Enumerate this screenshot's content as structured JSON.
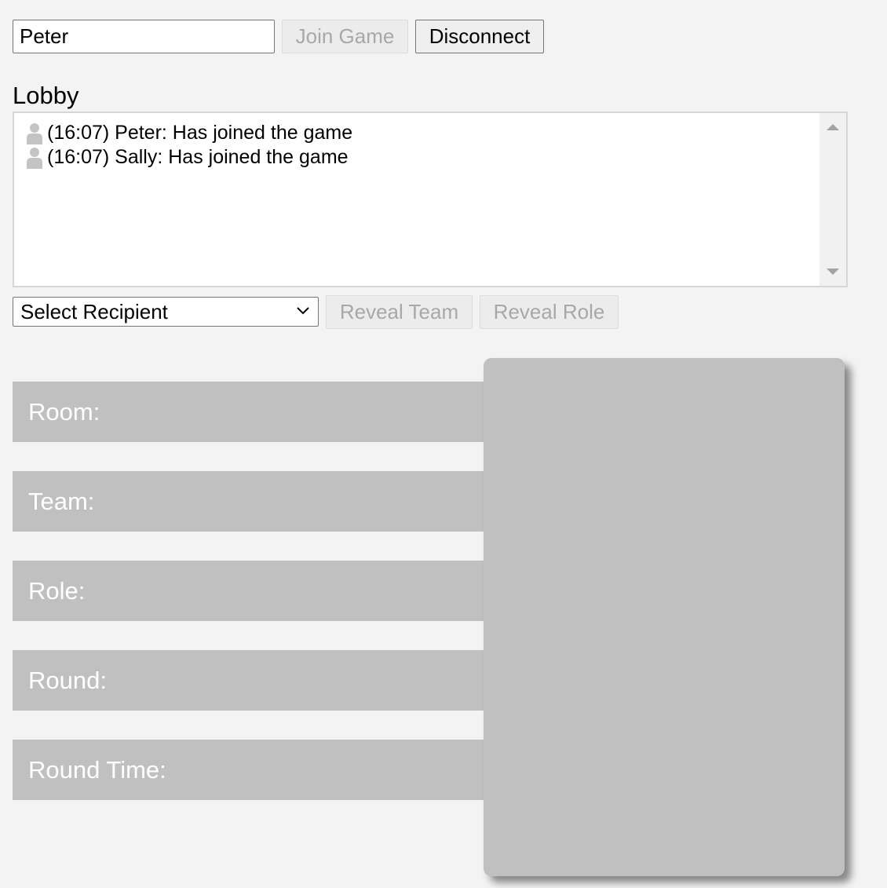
{
  "header": {
    "name_value": "Peter",
    "join_label": "Join Game",
    "disconnect_label": "Disconnect"
  },
  "lobby": {
    "title": "Lobby",
    "messages": [
      {
        "icon": "user-icon",
        "text": "(16:07) Peter: Has joined the game"
      },
      {
        "icon": "user-icon",
        "text": "(16:07) Sally: Has joined the game"
      }
    ]
  },
  "controls": {
    "recipient_selected": "Select Recipient",
    "reveal_team_label": "Reveal Team",
    "reveal_role_label": "Reveal Role"
  },
  "info": {
    "room_label": "Room:",
    "team_label": "Team:",
    "role_label": "Role:",
    "round_label": "Round:",
    "round_time_label": "Round Time:"
  },
  "colors": {
    "panel_gray": "#c0c0c0",
    "background": "#f3f3f3"
  }
}
